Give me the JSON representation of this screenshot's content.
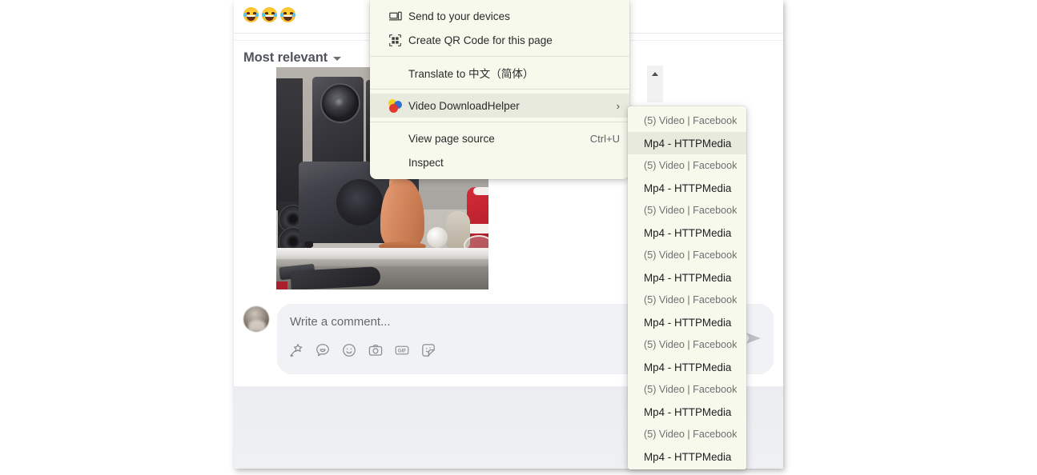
{
  "page": {
    "reactions": [
      {
        "name": "haha-reaction",
        "emoji": "😂"
      },
      {
        "name": "haha-reaction",
        "emoji": "😂"
      },
      {
        "name": "haha-reaction",
        "emoji": "😂"
      }
    ],
    "sort_label": "Most relevant",
    "sort_caret": "chevron-down-icon",
    "photo_alt": "Shelf with black speakers, wooden vase and red Santa decoration",
    "composer": {
      "placeholder": "Write a comment...",
      "value": "",
      "icons": [
        {
          "name": "magic-wand-icon",
          "title": "Comment effects"
        },
        {
          "name": "avatar-sticker-icon",
          "title": "Avatar sticker"
        },
        {
          "name": "emoji-icon",
          "title": "Insert an emoji"
        },
        {
          "name": "camera-icon",
          "title": "Attach a photo or video"
        },
        {
          "name": "gif-icon",
          "title": "Comment with a GIF",
          "text": "GIF"
        },
        {
          "name": "sticker-icon",
          "title": "Comment with a sticker"
        }
      ],
      "send_label": "Send"
    },
    "scrollbar": {
      "up_arrow": "scroll-up-arrow-icon"
    }
  },
  "context_menu": {
    "groups": [
      {
        "items": [
          {
            "name": "send-to-your-devices",
            "label": "Send to your devices",
            "icon": "devices-icon",
            "shortcut": "",
            "submenu": false,
            "hovered": false
          },
          {
            "name": "create-qr-code",
            "label": "Create QR Code for this page",
            "icon": "qr-code-icon",
            "shortcut": "",
            "submenu": false,
            "hovered": false
          }
        ]
      },
      {
        "items": [
          {
            "name": "translate-to-chinese",
            "label": "Translate to 中文（简体）",
            "icon": "",
            "shortcut": "",
            "submenu": false,
            "hovered": false
          }
        ]
      },
      {
        "items": [
          {
            "name": "video-downloadhelper",
            "label": "Video DownloadHelper",
            "icon": "vdh-icon",
            "shortcut": "",
            "submenu": true,
            "submenu_arrow": "›",
            "hovered": true
          }
        ]
      },
      {
        "items": [
          {
            "name": "view-page-source",
            "label": "View page source",
            "icon": "",
            "shortcut": "Ctrl+U",
            "submenu": false,
            "hovered": false
          },
          {
            "name": "inspect",
            "label": "Inspect",
            "icon": "",
            "shortcut": "",
            "submenu": false,
            "hovered": false
          }
        ]
      }
    ]
  },
  "vdh_submenu": {
    "items": [
      {
        "name": "vdh-source-item",
        "label": "(5) Video | Facebook",
        "kind": "src",
        "hovered": false
      },
      {
        "name": "vdh-media-item",
        "label": "Mp4 - HTTPMedia",
        "kind": "media",
        "hovered": true
      },
      {
        "name": "vdh-source-item",
        "label": "(5) Video | Facebook",
        "kind": "src",
        "hovered": false
      },
      {
        "name": "vdh-media-item",
        "label": "Mp4 - HTTPMedia",
        "kind": "media",
        "hovered": false
      },
      {
        "name": "vdh-source-item",
        "label": "(5) Video | Facebook",
        "kind": "src",
        "hovered": false
      },
      {
        "name": "vdh-media-item",
        "label": "Mp4 - HTTPMedia",
        "kind": "media",
        "hovered": false
      },
      {
        "name": "vdh-source-item",
        "label": "(5) Video | Facebook",
        "kind": "src",
        "hovered": false
      },
      {
        "name": "vdh-media-item",
        "label": "Mp4 - HTTPMedia",
        "kind": "media",
        "hovered": false
      },
      {
        "name": "vdh-source-item",
        "label": "(5) Video | Facebook",
        "kind": "src",
        "hovered": false
      },
      {
        "name": "vdh-media-item",
        "label": "Mp4 - HTTPMedia",
        "kind": "media",
        "hovered": false
      },
      {
        "name": "vdh-source-item",
        "label": "(5) Video | Facebook",
        "kind": "src",
        "hovered": false
      },
      {
        "name": "vdh-media-item",
        "label": "Mp4 - HTTPMedia",
        "kind": "media",
        "hovered": false
      },
      {
        "name": "vdh-source-item",
        "label": "(5) Video | Facebook",
        "kind": "src",
        "hovered": false
      },
      {
        "name": "vdh-media-item",
        "label": "Mp4 - HTTPMedia",
        "kind": "media",
        "hovered": false
      },
      {
        "name": "vdh-source-item",
        "label": "(5) Video | Facebook",
        "kind": "src",
        "hovered": false
      },
      {
        "name": "vdh-media-item",
        "label": "Mp4 - HTTPMedia",
        "kind": "media",
        "hovered": false
      }
    ]
  },
  "colors": {
    "menu_background": "#f6f9ec",
    "menu_hover": "#e9eade",
    "menu_separator": "#dfe4d2",
    "composer_background": "#f0f2f5",
    "page_grey": "#eceef1",
    "text_primary": "#2b2b2b",
    "text_muted": "#6f6f6f"
  }
}
